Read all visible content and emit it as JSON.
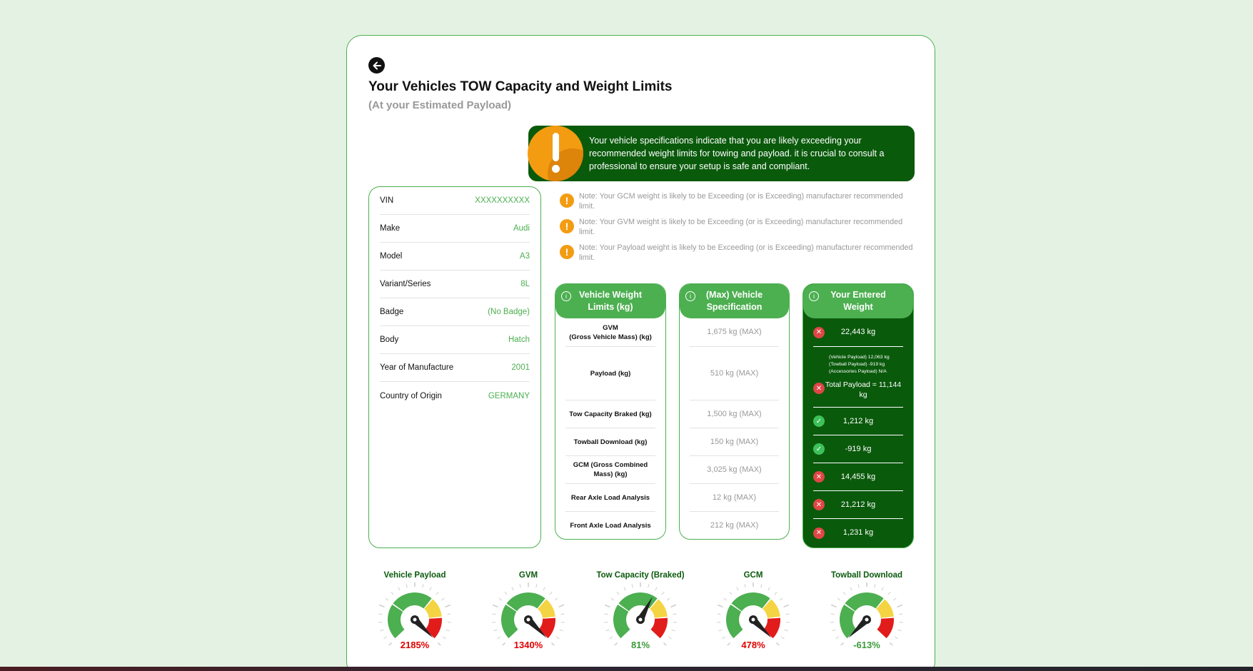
{
  "page": {
    "title": "Your Vehicles TOW Capacity and Weight Limits",
    "subtitle": "(At your Estimated Payload)"
  },
  "alert": {
    "text": "Your vehicle specifications indicate that you are likely exceeding your recommended weight limits for towing and payload. it is crucial to consult a professional to ensure your setup is safe and compliant."
  },
  "vehicle": [
    {
      "label": "VIN",
      "value": "XXXXXXXXXX"
    },
    {
      "label": "Make",
      "value": "Audi"
    },
    {
      "label": "Model",
      "value": "A3"
    },
    {
      "label": "Variant/Series",
      "value": "8L"
    },
    {
      "label": "Badge",
      "value": "(No Badge)"
    },
    {
      "label": "Body",
      "value": "Hatch"
    },
    {
      "label": "Year of Manufacture",
      "value": "2001"
    },
    {
      "label": "Country of Origin",
      "value": "GERMANY"
    }
  ],
  "notes": [
    "Note: Your GCM weight is likely to be Exceeding (or is Exceeding) manufacturer recommended limit.",
    "Note: Your GVM weight is likely to be Exceeding (or is Exceeding) manufacturer recommended limit.",
    "Note: Your Payload weight is likely to be Exceeding (or is Exceeding) manufacturer recommended limit."
  ],
  "columns": {
    "limits_header": "Vehicle Weight Limits (kg)",
    "spec_header": "(Max) Vehicle Specification",
    "entered_header": "Your Entered Weight"
  },
  "rows": {
    "gvm_line1": "GVM",
    "gvm_line2": "(Gross Vehicle Mass) (kg)",
    "labels": [
      "Payload (kg)",
      "Tow Capacity Braked (kg)",
      "Towball Download (kg)",
      "GCM (Gross Combined Mass) (kg)",
      "Rear Axle Load Analysis",
      "Front Axle Load Analysis"
    ],
    "specs": [
      "1,675 kg (MAX)",
      "510 kg (MAX)",
      "1,500 kg (MAX)",
      "150 kg (MAX)",
      "3,025 kg (MAX)",
      "12 kg (MAX)",
      "212 kg (MAX)"
    ],
    "entered_gvm": "22,443 kg",
    "payload_detail_1": "(Vehicle Payload) 12,063 kg",
    "payload_detail_2": "(Towball Payload) -919 kg",
    "payload_detail_3": "(Accessories Payload) N/A",
    "payload_total": "Total Payload = 11,144 kg",
    "entered": [
      "1,212 kg",
      "-919 kg",
      "14,455 kg",
      "21,212 kg",
      "1,231 kg"
    ]
  },
  "gauges": [
    {
      "label": "Vehicle Payload",
      "value_text": "2185%",
      "percent": 2185,
      "color": "#e00000"
    },
    {
      "label": "GVM",
      "value_text": "1340%",
      "percent": 1340,
      "color": "#e00000"
    },
    {
      "label": "Tow Capacity (Braked)",
      "value_text": "81%",
      "percent": 81,
      "color": "#3a9a3a"
    },
    {
      "label": "GCM",
      "value_text": "478%",
      "percent": 478,
      "color": "#e00000"
    },
    {
      "label": "Towball Download",
      "value_text": "-613%",
      "percent": -613,
      "color": "#3a9a3a"
    }
  ],
  "colors": {
    "brand_green": "#4caf50",
    "dark_green": "#0a5a0c",
    "warning": "#f39c12",
    "danger": "#e04646"
  }
}
